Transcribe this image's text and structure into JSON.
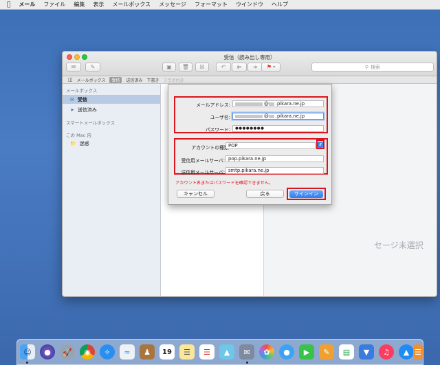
{
  "menubar": {
    "app": "メール",
    "items": [
      "ファイル",
      "編集",
      "表示",
      "メールボックス",
      "メッセージ",
      "フォーマット",
      "ウインドウ",
      "ヘルプ"
    ]
  },
  "window": {
    "title": "受信（読み出し専用）",
    "search_placeholder": "検索"
  },
  "favorites": {
    "mailboxes": "メールボックス",
    "inbox": "受信",
    "sent": "送信済み",
    "drafts": "下書き",
    "flagged": "フラグ付き"
  },
  "sidebar": {
    "header_mailboxes": "メールボックス",
    "inbox": "受信",
    "sent": "送信済み",
    "header_smart": "スマートメールボックス",
    "header_mac": "この Mac 内",
    "junk": "迷惑"
  },
  "detail": {
    "no_message": "セージ未選択"
  },
  "dialog": {
    "email_label": "メールアドレス:",
    "email_domain": "@",
    "email_suffix": ".pikara.ne.jp",
    "username_label": "ユーザ名:",
    "username_domain": "@",
    "username_suffix": ".pikara.ne.jp",
    "password_label": "パスワード:",
    "password_value": "●●●●●●●●",
    "account_type_label": "アカウントの種類:",
    "account_type_value": "POP",
    "incoming_label": "受信用メールサーバ:",
    "incoming_value": "pop.pikara.ne.jp",
    "outgoing_label": "送信用メールサーバ:",
    "outgoing_value": "smtp.pikara.ne.jp",
    "error": "アカウント名またはパスワードを確認できません。",
    "cancel": "キャンセル",
    "back": "戻る",
    "signin": "サインイン"
  },
  "dock": {
    "calendar_day": "19"
  },
  "colors": {
    "highlight_red": "#d9141d",
    "accent_blue": "#2f7cef",
    "desktop": "#4a7cc4"
  }
}
